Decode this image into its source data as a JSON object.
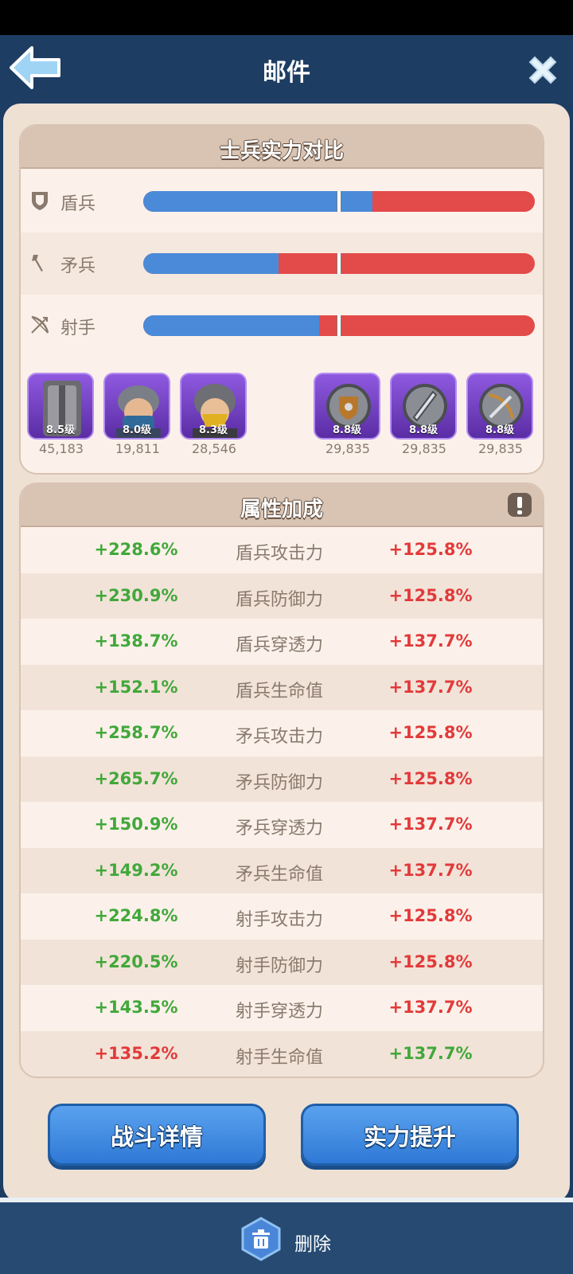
{
  "header": {
    "title": "邮件"
  },
  "comparison": {
    "title": "士兵实力对比",
    "rows": [
      {
        "label": "盾兵",
        "icon": "shield-icon",
        "left_share": 0.585
      },
      {
        "label": "矛兵",
        "icon": "spear-icon",
        "left_share": 0.345
      },
      {
        "label": "射手",
        "icon": "bow-icon",
        "left_share": 0.45
      }
    ],
    "colors": {
      "left": "#4a8ad8",
      "right": "#e34a4a"
    }
  },
  "units": {
    "left": [
      {
        "level": "8.5级",
        "count": "45,183",
        "icon": "shield-soldier-icon"
      },
      {
        "level": "8.0级",
        "count": "19,811",
        "icon": "spear-soldier-icon"
      },
      {
        "level": "8.3级",
        "count": "28,546",
        "icon": "archer-soldier-icon"
      }
    ],
    "right": [
      {
        "level": "8.8级",
        "count": "29,835",
        "icon": "shield-emblem-icon"
      },
      {
        "level": "8.8级",
        "count": "29,835",
        "icon": "spear-emblem-icon"
      },
      {
        "level": "8.8级",
        "count": "29,835",
        "icon": "bow-emblem-icon"
      }
    ]
  },
  "attributes": {
    "title": "属性加成",
    "rows": [
      {
        "left": "+228.6%",
        "name": "盾兵攻击力",
        "right": "+125.8%",
        "left_color": "green",
        "right_color": "red"
      },
      {
        "left": "+230.9%",
        "name": "盾兵防御力",
        "right": "+125.8%",
        "left_color": "green",
        "right_color": "red"
      },
      {
        "left": "+138.7%",
        "name": "盾兵穿透力",
        "right": "+137.7%",
        "left_color": "green",
        "right_color": "red"
      },
      {
        "left": "+152.1%",
        "name": "盾兵生命值",
        "right": "+137.7%",
        "left_color": "green",
        "right_color": "red"
      },
      {
        "left": "+258.7%",
        "name": "矛兵攻击力",
        "right": "+125.8%",
        "left_color": "green",
        "right_color": "red"
      },
      {
        "left": "+265.7%",
        "name": "矛兵防御力",
        "right": "+125.8%",
        "left_color": "green",
        "right_color": "red"
      },
      {
        "left": "+150.9%",
        "name": "矛兵穿透力",
        "right": "+137.7%",
        "left_color": "green",
        "right_color": "red"
      },
      {
        "left": "+149.2%",
        "name": "矛兵生命值",
        "right": "+137.7%",
        "left_color": "green",
        "right_color": "red"
      },
      {
        "left": "+224.8%",
        "name": "射手攻击力",
        "right": "+125.8%",
        "left_color": "green",
        "right_color": "red"
      },
      {
        "left": "+220.5%",
        "name": "射手防御力",
        "right": "+125.8%",
        "left_color": "green",
        "right_color": "red"
      },
      {
        "left": "+143.5%",
        "name": "射手穿透力",
        "right": "+137.7%",
        "left_color": "green",
        "right_color": "red"
      },
      {
        "left": "+135.2%",
        "name": "射手生命值",
        "right": "+137.7%",
        "left_color": "red",
        "right_color": "green"
      }
    ]
  },
  "buttons": {
    "battle_details": "战斗详情",
    "power_up": "实力提升"
  },
  "footer": {
    "delete_label": "删除"
  }
}
